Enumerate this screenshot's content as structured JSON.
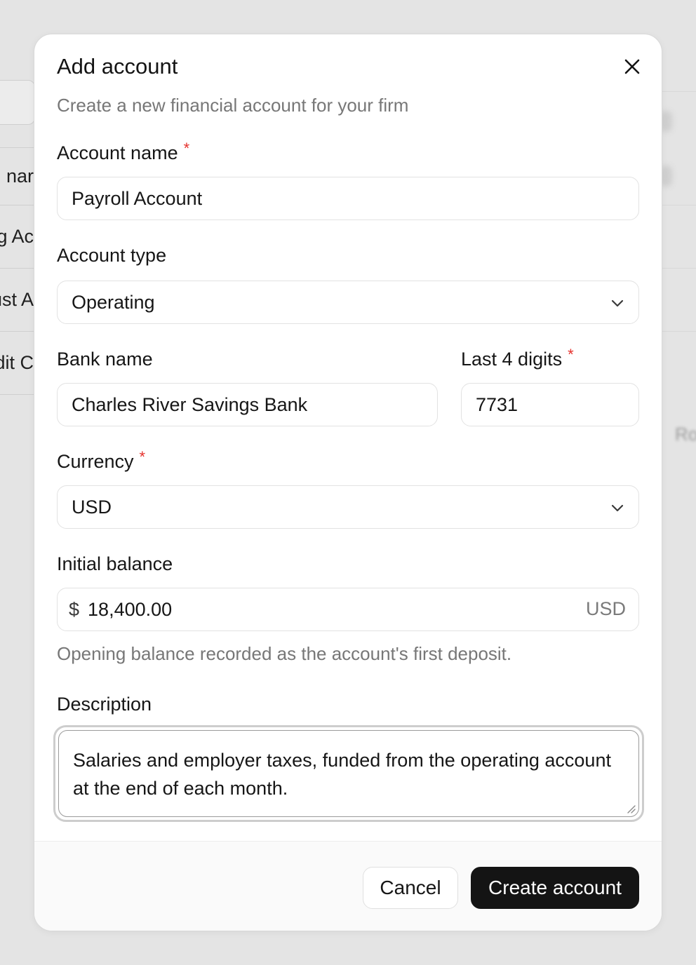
{
  "background": {
    "row_labels": [
      "nar",
      "ng Ac",
      "ust A",
      "edit C"
    ],
    "right_label": "Ro"
  },
  "dialog": {
    "title": "Add account",
    "subtitle": "Create a new financial account for your firm",
    "close_icon": "close-icon"
  },
  "fields": {
    "account_name": {
      "label": "Account name",
      "required": "*",
      "value": "Payroll Account"
    },
    "account_type": {
      "label": "Account type",
      "value": "Operating",
      "icon": "chevron-down-icon"
    },
    "bank_name": {
      "label": "Bank name",
      "value": "Charles River Savings Bank"
    },
    "last4": {
      "label": "Last 4 digits",
      "required": "*",
      "value": "7731"
    },
    "currency": {
      "label": "Currency",
      "required": "*",
      "value": "USD",
      "icon": "chevron-down-icon"
    },
    "initial_balance": {
      "label": "Initial balance",
      "prefix": "$",
      "value": "18,400.00",
      "suffix": "USD",
      "help": "Opening balance recorded as the account's first deposit."
    },
    "description": {
      "label": "Description",
      "value": "Salaries and employer taxes, funded from the operating account at the end of each month."
    }
  },
  "footer": {
    "cancel_label": "Cancel",
    "create_label": "Create account"
  },
  "colors": {
    "required": "#e5322d",
    "primary_button": "#141414",
    "muted_text": "#777777"
  }
}
